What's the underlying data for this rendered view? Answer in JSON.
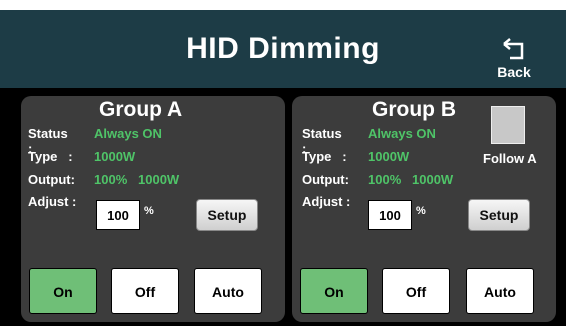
{
  "header": {
    "title": "HID Dimming",
    "back_label": "Back"
  },
  "labels": {
    "status": "Status :",
    "type": "Type   :",
    "output": "Output:",
    "adjust": "Adjust :",
    "percent": "%"
  },
  "groups": [
    {
      "name": "Group A",
      "status": "Always ON",
      "type": "1000W",
      "output_pct": "100%",
      "output_w": "1000W",
      "adjust": "100",
      "setup_label": "Setup",
      "modes": [
        "On",
        "Off",
        "Auto"
      ],
      "active_mode": "On"
    },
    {
      "name": "Group B",
      "status": "Always ON",
      "type": "1000W",
      "output_pct": "100%",
      "output_w": "1000W",
      "adjust": "100",
      "setup_label": "Setup",
      "follow_label": "Follow A",
      "follow_checked": false,
      "modes": [
        "On",
        "Off",
        "Auto"
      ],
      "active_mode": "On"
    }
  ],
  "colors": {
    "header_bg": "#1d3c46",
    "panel_bg": "#3c3c3c",
    "value_green": "#4fc468",
    "on_green": "#6fbf77"
  }
}
